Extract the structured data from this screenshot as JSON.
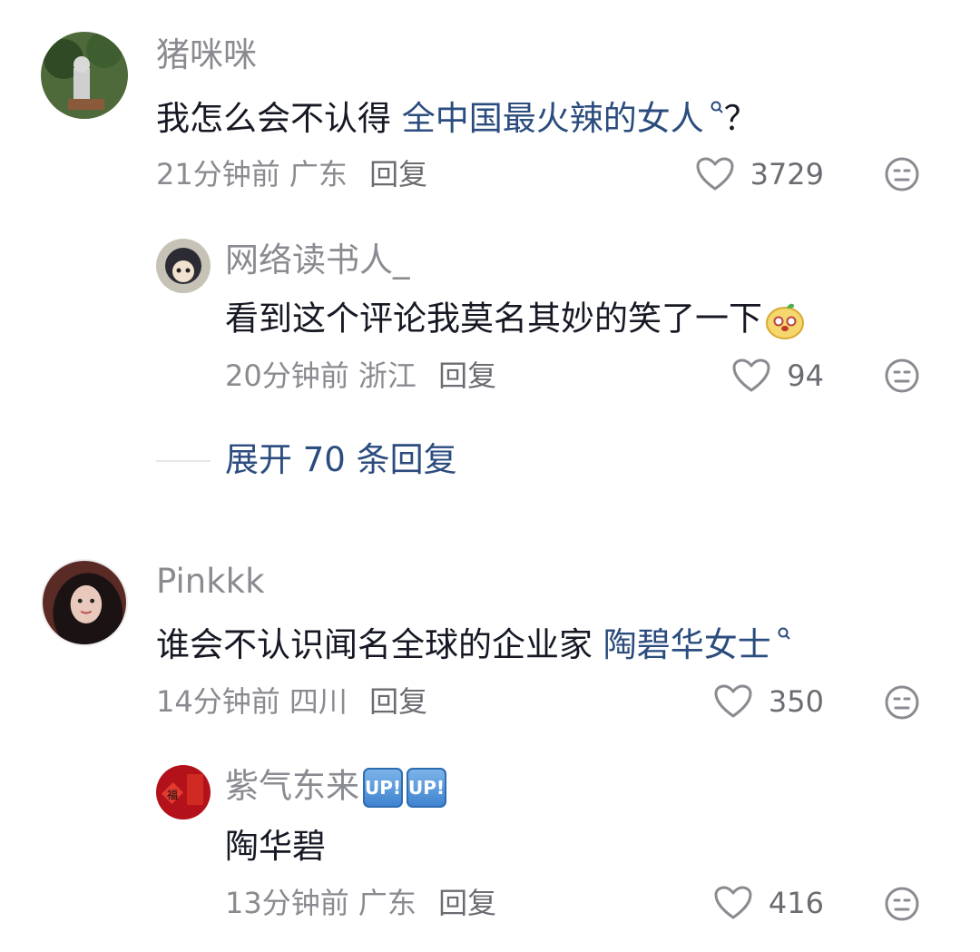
{
  "comments": [
    {
      "username": "猪咪咪",
      "text_prefix": "我怎么会不认得 ",
      "text_link": "全中国最火辣的女人",
      "text_suffix": "？",
      "time": "21分钟前",
      "location": "广东",
      "reply_label": "回复",
      "likes": "3729",
      "replies": [
        {
          "username": "网络读书人_",
          "text": "看到这个评论我莫名其妙的笑了一下",
          "time": "20分钟前",
          "location": "浙江",
          "reply_label": "回复",
          "likes": "94"
        }
      ],
      "expand_label": "展开 70 条回复"
    },
    {
      "username": "Pinkkk",
      "text_prefix": "谁会不认识闻名全球的企业家 ",
      "text_link": "陶碧华女士",
      "time": "14分钟前",
      "location": "四川",
      "reply_label": "回复",
      "likes": "350",
      "replies": [
        {
          "username": "紫气东来",
          "badges": [
            "UP!",
            "UP!"
          ],
          "text": "陶华碧",
          "time": "13分钟前",
          "location": "广东",
          "reply_label": "回复",
          "likes": "416"
        }
      ]
    }
  ],
  "colors": {
    "link": "#2b4c7e",
    "meta": "#8a8b91",
    "text": "#161823",
    "badge": "#3d82cf"
  },
  "icons": [
    "heart-icon",
    "dislike-face-icon",
    "search-icon",
    "emoji-sticker-icon"
  ]
}
